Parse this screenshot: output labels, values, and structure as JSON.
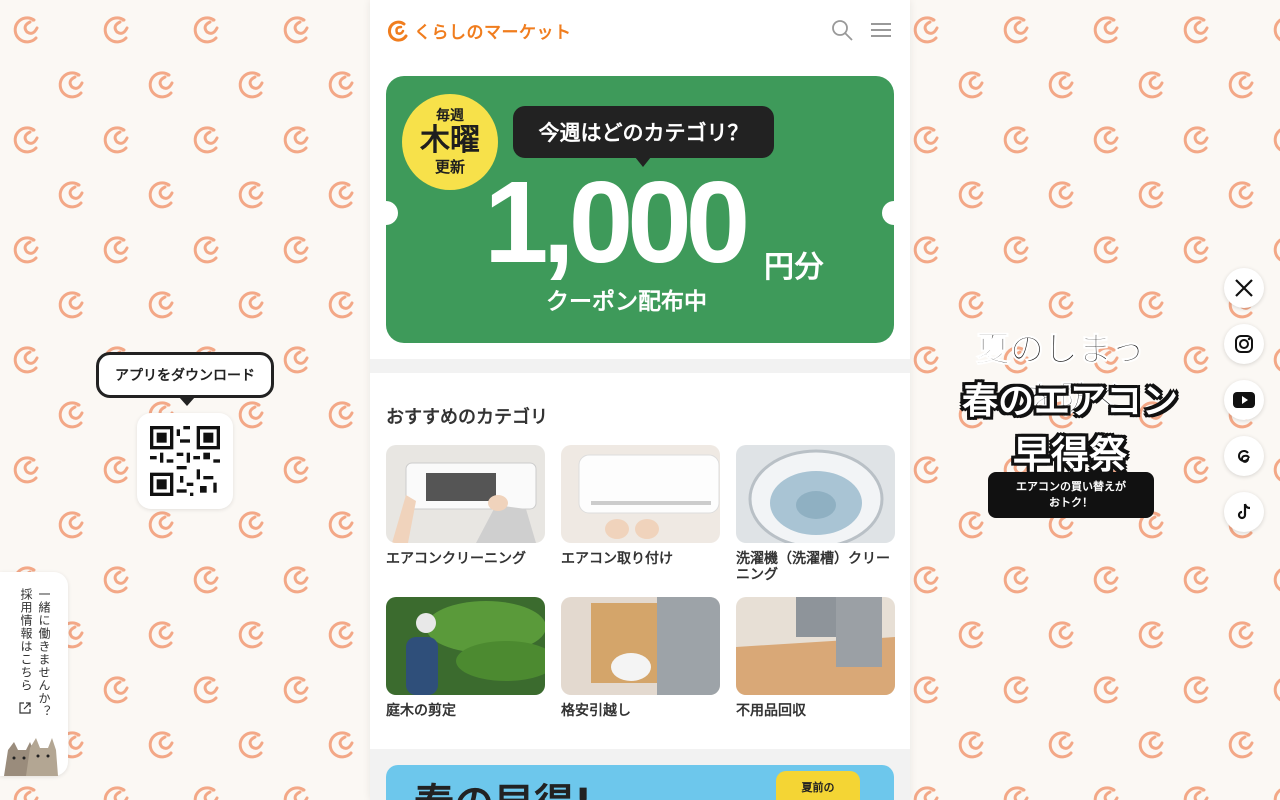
{
  "brand": {
    "name": "くらしのマーケット",
    "accent": "#f07d1e"
  },
  "header": {
    "search_icon": "search-icon",
    "menu_icon": "hamburger-menu-icon"
  },
  "hero": {
    "badge_top": "毎週",
    "badge_mid": "木曜",
    "badge_bottom": "更新",
    "bubble": "今週はどのカテゴリ？",
    "amount": "1,000",
    "amount_unit": "円分",
    "sub": "クーポン配布中",
    "bg_color": "#3e9a5a"
  },
  "categories": {
    "title": "おすすめのカテゴリ",
    "items": [
      {
        "label": "エアコンクリーニング"
      },
      {
        "label": "エアコン取り付け"
      },
      {
        "label": "洗濯機（洗濯槽）クリーニング"
      },
      {
        "label": "庭木の剪定"
      },
      {
        "label": "格安引越し"
      },
      {
        "label": "不用品回収"
      }
    ]
  },
  "banner2": {
    "big": "春の早得!",
    "tag": "夏前の"
  },
  "left": {
    "app_download": "アプリをダウンロード",
    "recruit_line1": "一緒に働きませんか？",
    "recruit_line2": "採用情報はこちら"
  },
  "promo": {
    "line1": "夏のしまった!を防ぐ",
    "line2": "春のエアコン",
    "line3": "早得祭",
    "pill_line1": "エアコンの買い替えが",
    "pill_line2": "おトク！"
  },
  "social": [
    "x-icon",
    "instagram-icon",
    "youtube-icon",
    "threads-icon",
    "tiktok-icon"
  ]
}
